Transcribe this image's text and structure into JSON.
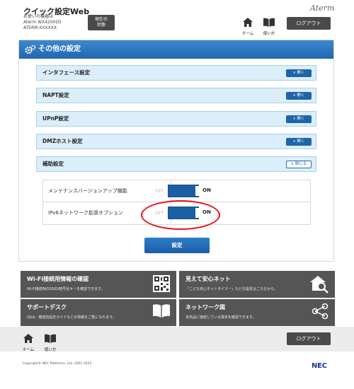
{
  "header": {
    "title": "クイック設定Web",
    "device_line1": "お使いの機器は",
    "device_line2": "Aterm WX4200D5",
    "device_line3": "ATERM-XXXXXX",
    "status_btn_line1": "現在の",
    "status_btn_line2": "状態",
    "logo": "Aterm",
    "home_label": "ホーム",
    "manual_label": "使い方",
    "logout_label": "ログアウト"
  },
  "panel": {
    "title": "その他の設定",
    "sections": [
      {
        "label": "インタフェース設定",
        "button": "開く"
      },
      {
        "label": "NAPT設定",
        "button": "開く"
      },
      {
        "label": "UPnP設定",
        "button": "開く"
      },
      {
        "label": "DMZホスト設定",
        "button": "開く"
      },
      {
        "label": "補助設定",
        "button": "閉じる"
      }
    ],
    "options": [
      {
        "label": "メンテナンスバージョンアップ機能",
        "off": "OFF",
        "on": "ON"
      },
      {
        "label": "IPv6ネットワーク拡張オプション",
        "off": "OFF",
        "on": "ON"
      }
    ],
    "submit_label": "設定"
  },
  "tiles": [
    {
      "title": "Wi-Fi接続用情報の確認",
      "desc": "Wi-Fi接続用のSSID/暗号化キーを確認できます。",
      "icon": "qr-code-icon"
    },
    {
      "title": "見えて安心ネット",
      "desc": "「こども安心ネットタイマー」などの設定はこちらから。",
      "icon": "house-search-icon"
    },
    {
      "title": "サポートデスク",
      "desc": "Q&A、機能別設定ガイドなどの情報をご覧になれます。",
      "icon": "book-icon"
    },
    {
      "title": "ネットワーク図",
      "desc": "本商品に接続している端末を確認できます。",
      "icon": "network-icon"
    }
  ],
  "footer": {
    "home_label": "ホーム",
    "manual_label": "使い方",
    "logout_label": "ログアウト",
    "copyright": "Copyright© NEC Platforms, Ltd. 2001-2023",
    "brand": "NEC"
  },
  "colors": {
    "accent_blue": "#1f68b0",
    "section_bg": "#dbeef9",
    "tile_bg": "#555555",
    "annotation_red": "#e8141a"
  }
}
